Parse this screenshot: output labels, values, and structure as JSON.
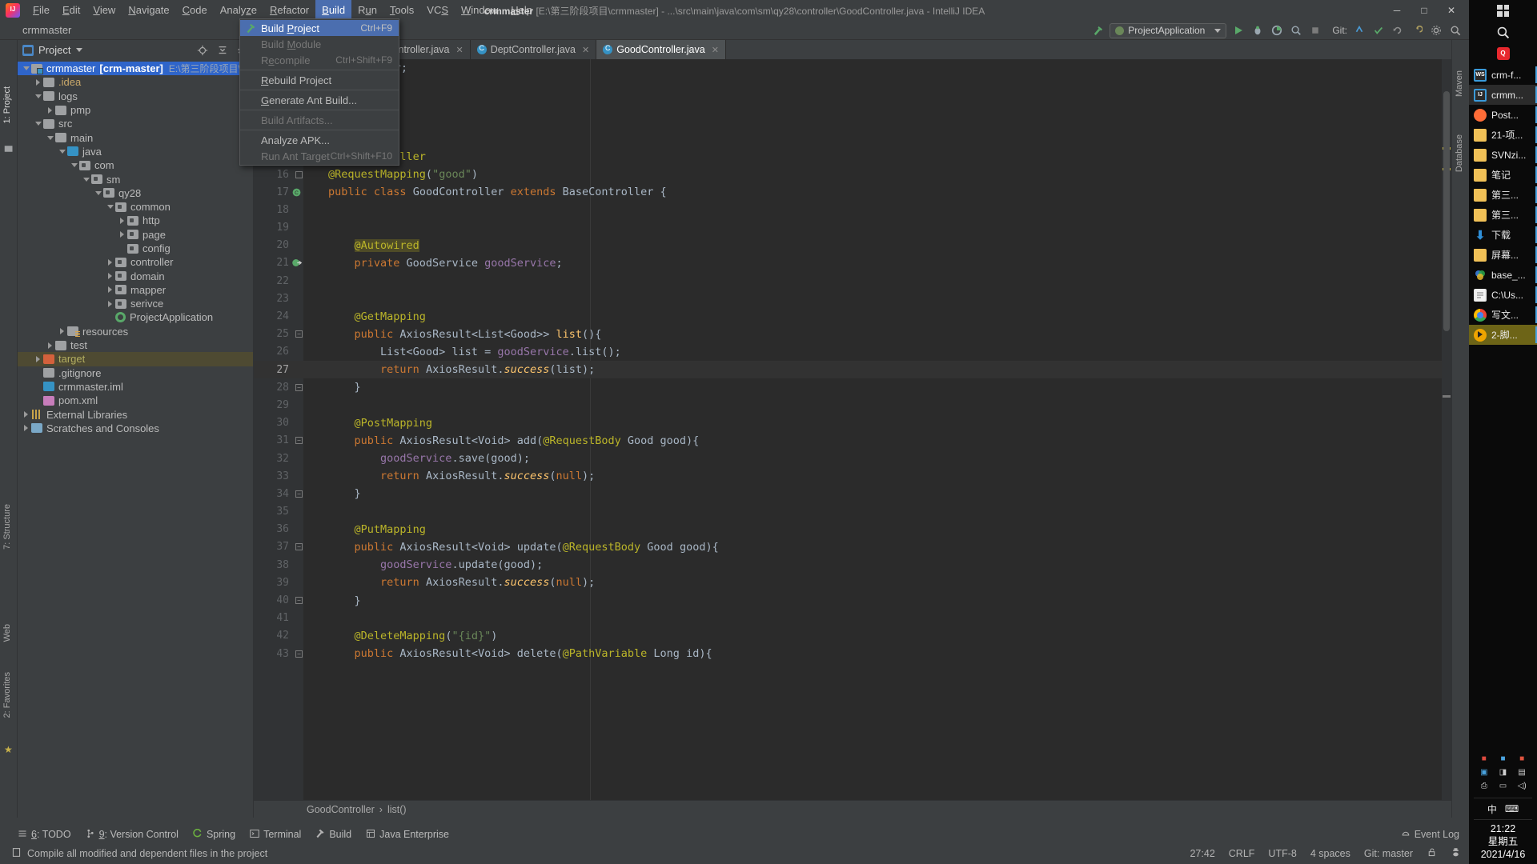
{
  "window": {
    "title_project": "crmmaster",
    "title_rest": "[E:\\第三阶段项目\\crmmaster] - ...\\src\\main\\java\\com\\sm\\qy28\\controller\\GoodController.java - IntelliJ IDEA",
    "minimize": "─",
    "maximize": "□",
    "close": "✕"
  },
  "menubar": {
    "items": [
      {
        "label": "File",
        "accel": "F"
      },
      {
        "label": "Edit",
        "accel": "E"
      },
      {
        "label": "View",
        "accel": "V"
      },
      {
        "label": "Navigate",
        "accel": "N"
      },
      {
        "label": "Code",
        "accel": "C"
      },
      {
        "label": "Analyze",
        "accel": "z"
      },
      {
        "label": "Refactor",
        "accel": "R"
      },
      {
        "label": "Build",
        "accel": "B",
        "active": true
      },
      {
        "label": "Run",
        "accel": "u"
      },
      {
        "label": "Tools",
        "accel": "T"
      },
      {
        "label": "VCS",
        "accel": "S"
      },
      {
        "label": "Window",
        "accel": "W"
      },
      {
        "label": "Help",
        "accel": "H"
      }
    ]
  },
  "build_menu": {
    "items": [
      {
        "label": "Build Project",
        "shortcut": "Ctrl+F9",
        "selected": true,
        "disabled": false,
        "icon": "hammer-icon"
      },
      {
        "label": "Build Module",
        "shortcut": "",
        "selected": false,
        "disabled": true
      },
      {
        "label": "Recompile",
        "shortcut": "Ctrl+Shift+F9",
        "selected": false,
        "disabled": true
      },
      {
        "separator": true
      },
      {
        "label": "Rebuild Project",
        "shortcut": "",
        "selected": false,
        "disabled": false
      },
      {
        "separator": true
      },
      {
        "label": "Generate Ant Build...",
        "shortcut": "",
        "selected": false,
        "disabled": false
      },
      {
        "separator": true
      },
      {
        "label": "Build Artifacts...",
        "shortcut": "",
        "selected": false,
        "disabled": true
      },
      {
        "separator": true
      },
      {
        "label": "Analyze APK...",
        "shortcut": "",
        "selected": false,
        "disabled": false
      },
      {
        "label": "Run Ant Target",
        "shortcut": "Ctrl+Shift+F10",
        "selected": false,
        "disabled": true
      }
    ]
  },
  "toolbar": {
    "project_name": "crmmaster",
    "run_config": "ProjectApplication",
    "git_label": "Git:"
  },
  "project_panel": {
    "title": "Project",
    "tree": [
      {
        "depth": 0,
        "arrow": "open",
        "icon": "module",
        "name": "crmmaster",
        "bold_part": "[crm-master]",
        "path": "E:\\第三阶段项目\\crmmaster",
        "selected": true
      },
      {
        "depth": 1,
        "arrow": "closed",
        "icon": "grey",
        "name": ".idea",
        "style": "idea"
      },
      {
        "depth": 1,
        "arrow": "open",
        "icon": "grey",
        "name": "logs"
      },
      {
        "depth": 2,
        "arrow": "closed",
        "icon": "grey",
        "name": "pmp"
      },
      {
        "depth": 1,
        "arrow": "open",
        "icon": "grey",
        "name": "src"
      },
      {
        "depth": 2,
        "arrow": "open",
        "icon": "grey",
        "name": "main"
      },
      {
        "depth": 3,
        "arrow": "open",
        "icon": "blue",
        "name": "java"
      },
      {
        "depth": 4,
        "arrow": "open",
        "icon": "pkg",
        "name": "com"
      },
      {
        "depth": 5,
        "arrow": "open",
        "icon": "pkg",
        "name": "sm"
      },
      {
        "depth": 6,
        "arrow": "open",
        "icon": "pkg",
        "name": "qy28"
      },
      {
        "depth": 7,
        "arrow": "open",
        "icon": "pkg",
        "name": "common"
      },
      {
        "depth": 8,
        "arrow": "closed",
        "icon": "pkg",
        "name": "http"
      },
      {
        "depth": 8,
        "arrow": "closed",
        "icon": "pkg",
        "name": "page"
      },
      {
        "depth": 8,
        "arrow": "none",
        "icon": "pkg",
        "name": "config"
      },
      {
        "depth": 7,
        "arrow": "closed",
        "icon": "pkg",
        "name": "controller"
      },
      {
        "depth": 7,
        "arrow": "closed",
        "icon": "pkg",
        "name": "domain"
      },
      {
        "depth": 7,
        "arrow": "closed",
        "icon": "pkg",
        "name": "mapper"
      },
      {
        "depth": 7,
        "arrow": "closed",
        "icon": "pkg",
        "name": "serivce"
      },
      {
        "depth": 7,
        "arrow": "none",
        "icon": "spring",
        "name": "ProjectApplication"
      },
      {
        "depth": 3,
        "arrow": "closed",
        "icon": "res",
        "name": "resources"
      },
      {
        "depth": 2,
        "arrow": "closed",
        "icon": "grey",
        "name": "test"
      },
      {
        "depth": 1,
        "arrow": "closed",
        "icon": "orange",
        "name": "target",
        "style": "target",
        "target": true
      },
      {
        "depth": 1,
        "arrow": "none",
        "icon": "gitignore",
        "name": ".gitignore"
      },
      {
        "depth": 1,
        "arrow": "none",
        "icon": "idea-file",
        "name": "crmmaster.iml"
      },
      {
        "depth": 1,
        "arrow": "none",
        "icon": "mvn",
        "name": "pom.xml"
      },
      {
        "depth": 0,
        "arrow": "closed",
        "icon": "lib",
        "name": "External Libraries"
      },
      {
        "depth": 0,
        "arrow": "closed",
        "icon": "scratch",
        "name": "Scratches and Consoles"
      }
    ]
  },
  "editor": {
    "tabs": [
      {
        "label": "inController.java",
        "active": false,
        "clipped": true
      },
      {
        "label": "CategoryController.java",
        "active": false
      },
      {
        "label": "DeptController.java",
        "active": false
      },
      {
        "label": "GoodController.java",
        "active": true
      }
    ],
    "top_partial_line": "qy28.controller;",
    "lines": [
      {
        "n": 15,
        "text": "@RestController",
        "fold": "top"
      },
      {
        "n": 16,
        "text": "@RequestMapping(\"good\")",
        "fold": "mid"
      },
      {
        "n": 17,
        "text": "public class GoodController extends BaseController {",
        "gutter": "class-icon"
      },
      {
        "n": 18,
        "text": ""
      },
      {
        "n": 19,
        "text": ""
      },
      {
        "n": 20,
        "text": "    @Autowired",
        "highlight_word": "@Autowired"
      },
      {
        "n": 21,
        "text": "    private GoodService goodService;",
        "gutter": "bean-icon"
      },
      {
        "n": 22,
        "text": ""
      },
      {
        "n": 23,
        "text": ""
      },
      {
        "n": 24,
        "text": "    @GetMapping"
      },
      {
        "n": 25,
        "text": "    public AxiosResult<List<Good>> list(){",
        "fold": "open"
      },
      {
        "n": 26,
        "text": "        List<Good> list = goodService.list();"
      },
      {
        "n": 27,
        "text": "        return AxiosResult.success(list);",
        "current": true
      },
      {
        "n": 28,
        "text": "    }",
        "fold": "close"
      },
      {
        "n": 29,
        "text": ""
      },
      {
        "n": 30,
        "text": "    @PostMapping"
      },
      {
        "n": 31,
        "text": "    public AxiosResult<Void> add(@RequestBody Good good){",
        "fold": "open"
      },
      {
        "n": 32,
        "text": "        goodService.save(good);"
      },
      {
        "n": 33,
        "text": "        return AxiosResult.success(null);"
      },
      {
        "n": 34,
        "text": "    }",
        "fold": "close"
      },
      {
        "n": 35,
        "text": ""
      },
      {
        "n": 36,
        "text": "    @PutMapping"
      },
      {
        "n": 37,
        "text": "    public AxiosResult<Void> update(@RequestBody Good good){",
        "fold": "open"
      },
      {
        "n": 38,
        "text": "        goodService.update(good);"
      },
      {
        "n": 39,
        "text": "        return AxiosResult.success(null);"
      },
      {
        "n": 40,
        "text": "    }",
        "fold": "close"
      },
      {
        "n": 41,
        "text": ""
      },
      {
        "n": 42,
        "text": "    @DeleteMapping(\"{id}\")"
      },
      {
        "n": 43,
        "text": "    public AxiosResult<Void> delete(@PathVariable Long id){",
        "fold": "open"
      }
    ],
    "breadcrumb": [
      "GoodController",
      "list()"
    ],
    "breadcrumb_sep": "›"
  },
  "left_strip": {
    "project_label": "1: Project",
    "structure_label": "7: Structure",
    "web_label": "Web",
    "favorites_label": "2: Favorites"
  },
  "right_strip": {
    "maven_label": "Maven",
    "database_label": "Database"
  },
  "bottom_toolwindows": [
    {
      "label": "6: TODO",
      "accel": "6",
      "icon": "todo-icon"
    },
    {
      "label": "9: Version Control",
      "accel": "9",
      "icon": "branch-icon"
    },
    {
      "label": "Spring",
      "icon": "spring-icon"
    },
    {
      "label": "Terminal",
      "icon": "terminal-icon"
    },
    {
      "label": "Build",
      "icon": "hammer-icon"
    },
    {
      "label": "Java Enterprise",
      "icon": "jee-icon"
    }
  ],
  "statusbar": {
    "message": "Compile all modified and dependent files in the project",
    "caret": "27:42",
    "line_sep": "CRLF",
    "encoding": "UTF-8",
    "indent": "4 spaces",
    "git_branch": "Git: master",
    "event_log": "Event Log"
  },
  "taskbar": {
    "items": [
      {
        "label": "crm-f...",
        "icon": "webstorm-icon",
        "state": "running"
      },
      {
        "label": "crmm...",
        "icon": "intellij-icon",
        "state": "active"
      },
      {
        "label": "Post...",
        "icon": "postman-icon",
        "state": "running"
      },
      {
        "label": "21-项...",
        "icon": "folder-icon",
        "state": "running"
      },
      {
        "label": "SVNzi...",
        "icon": "folder-icon",
        "state": "running"
      },
      {
        "label": "笔记",
        "icon": "folder-icon",
        "state": "running"
      },
      {
        "label": "第三...",
        "icon": "folder-icon",
        "state": "running"
      },
      {
        "label": "第三...",
        "icon": "folder-icon",
        "state": "running"
      },
      {
        "label": "下载",
        "icon": "download-icon",
        "state": "running"
      },
      {
        "label": "屏幕...",
        "icon": "folder-icon",
        "state": "running"
      },
      {
        "label": "base_...",
        "icon": "base-icon",
        "state": "running"
      },
      {
        "label": "C:\\Us...",
        "icon": "notepad-icon",
        "state": "running"
      },
      {
        "label": "写文...",
        "icon": "chrome-icon",
        "state": "running"
      },
      {
        "label": "2-脚...",
        "icon": "media-icon",
        "state": "highlighted"
      }
    ],
    "ime": "中",
    "clock_time": "21:22",
    "clock_day": "星期五",
    "clock_date": "2021/4/16"
  }
}
